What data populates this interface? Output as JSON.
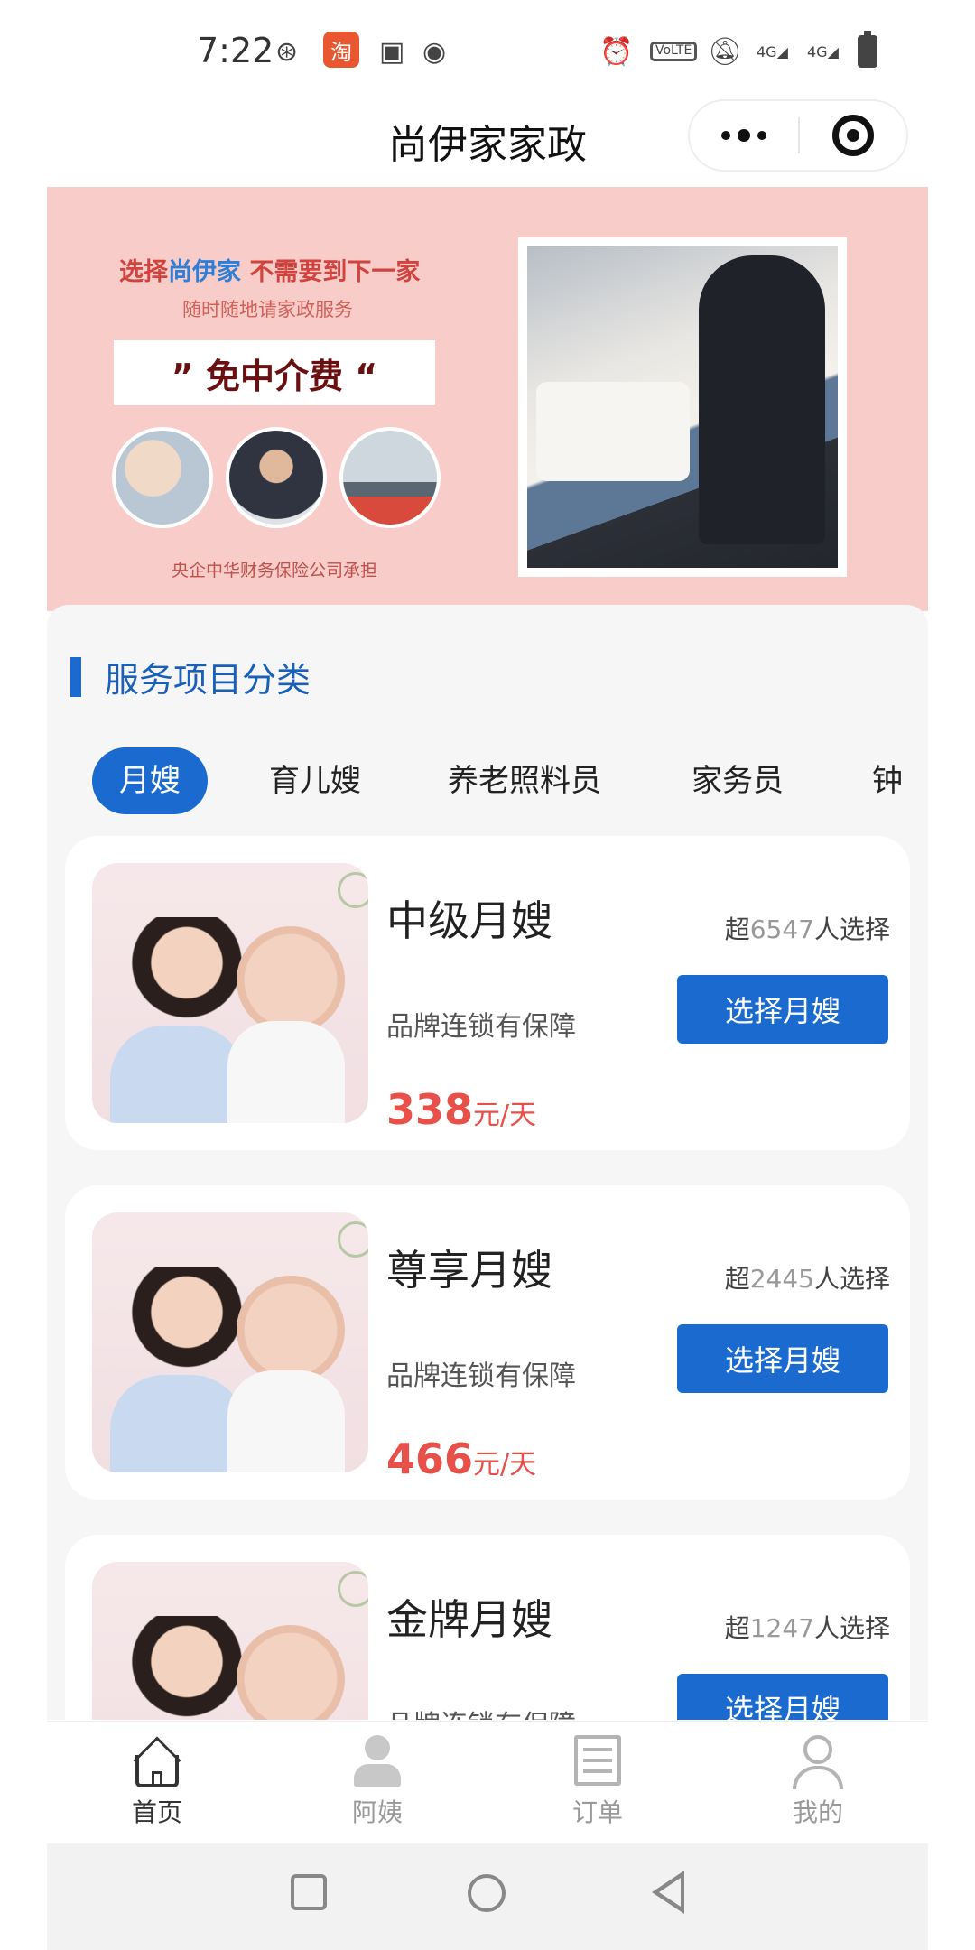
{
  "status_bar": {
    "time": "7:22",
    "icons": [
      "weibo-icon",
      "taobao-icon",
      "download-icon",
      "music-icon",
      "alarm-icon",
      "volte-icon",
      "mute-icon",
      "signal-4g-icon",
      "signal-4g-icon",
      "battery-icon"
    ],
    "taobao_badge": "淘",
    "volte_text": "VoLTE",
    "net1": "4G",
    "net2": "4G"
  },
  "header": {
    "title": "尚伊家家政"
  },
  "banner": {
    "line1_prefix": "选择",
    "line1_brand": "尚伊家",
    "line1_suffix": " 不需要到下一家",
    "line2": "随时随地请家政服务",
    "highlight": "” 免中介费 “",
    "footer": "央企中华财务保险公司承担"
  },
  "section": {
    "title": "服务项目分类"
  },
  "tabs": [
    "月嫂",
    "育儿嫂",
    "养老照料员",
    "家务员",
    "钟"
  ],
  "cards": [
    {
      "name": "中级月嫂",
      "subtitle": "品牌连锁有保障",
      "count_prefix": "超",
      "count": "6547",
      "count_suffix": "人选择",
      "button": "选择月嫂",
      "price": "338",
      "unit": "元/天"
    },
    {
      "name": "尊享月嫂",
      "subtitle": "品牌连锁有保障",
      "count_prefix": "超",
      "count": "2445",
      "count_suffix": "人选择",
      "button": "选择月嫂",
      "price": "466",
      "unit": "元/天"
    },
    {
      "name": "金牌月嫂",
      "subtitle": "品牌连锁有保障",
      "count_prefix": "超",
      "count": "1247",
      "count_suffix": "人选择",
      "button": "选择月嫂",
      "price": "",
      "unit": ""
    }
  ],
  "bottom_nav": [
    {
      "label": "首页",
      "icon": "home-icon",
      "active": true
    },
    {
      "label": "阿姨",
      "icon": "aunt-icon",
      "active": false
    },
    {
      "label": "订单",
      "icon": "order-icon",
      "active": false
    },
    {
      "label": "我的",
      "icon": "profile-icon",
      "active": false
    }
  ],
  "colors": {
    "accent": "#1a6ad0",
    "price": "#e8504a",
    "banner_bg": "#f8ccc8"
  }
}
